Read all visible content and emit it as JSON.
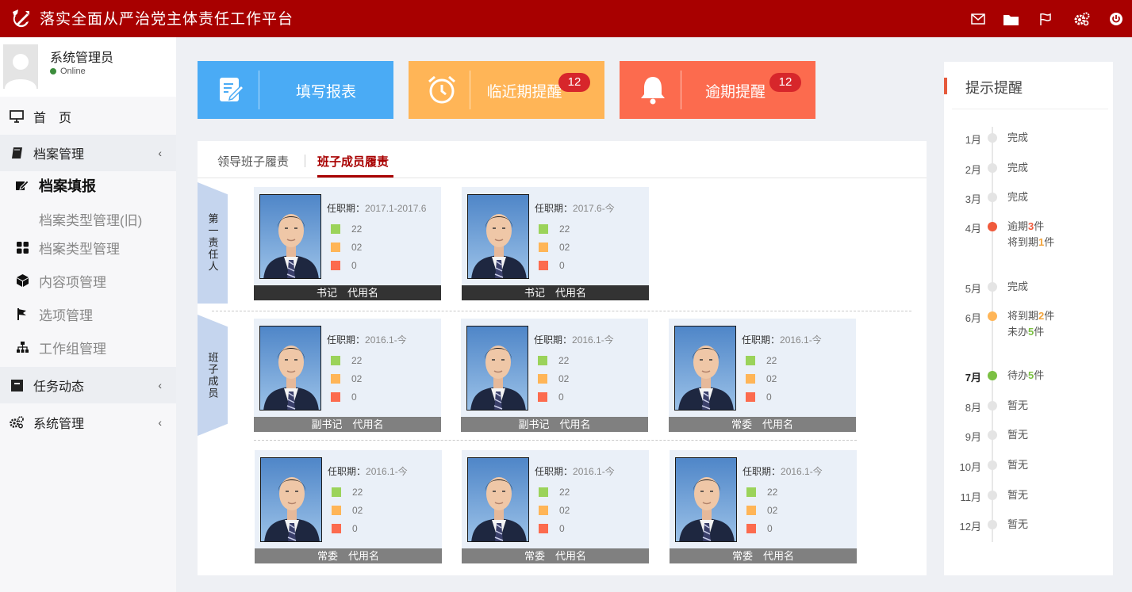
{
  "header": {
    "title": "落实全面从严治党主体责任工作平台",
    "icons": [
      "mail-icon",
      "folder-icon",
      "flag-icon",
      "settings-icon",
      "power-icon"
    ]
  },
  "user": {
    "name": "系统管理员",
    "status": "Online"
  },
  "nav": {
    "home": "首　页",
    "archive": "档案管理",
    "archive_fill": "档案填报",
    "archive_type_old": "档案类型管理(旧)",
    "archive_type": "档案类型管理",
    "content": "内容项管理",
    "options": "选项管理",
    "workgroup": "工作组管理",
    "task": "任务动态",
    "system": "系统管理"
  },
  "actions": [
    {
      "label": "填写报表",
      "color": "#4aabf5"
    },
    {
      "label": "临近期提醒",
      "badge": "12",
      "color": "#ffb557"
    },
    {
      "label": "逾期提醒",
      "badge": "12",
      "color": "#fc6b4e"
    }
  ],
  "tabs": {
    "tab1": "领导班子履责",
    "tab2": "班子成员履责"
  },
  "sections": {
    "first": "第一责任人",
    "members": "班子成员"
  },
  "term_label": "任职期：",
  "status_colors": {
    "done": "#9bd35a",
    "pending": "#ffb557",
    "overdue": "#fc6b4e"
  },
  "cards": [
    {
      "term": "2017.1-2017.6",
      "done": "22",
      "pending": "02",
      "overdue": "0",
      "footer": "书记　代用名"
    },
    {
      "term": "2017.6-今",
      "done": "22",
      "pending": "02",
      "overdue": "0",
      "footer": "书记　代用名"
    },
    {
      "term": "2016.1-今",
      "done": "22",
      "pending": "02",
      "overdue": "0",
      "footer": "副书记　代用名"
    },
    {
      "term": "2016.1-今",
      "done": "22",
      "pending": "02",
      "overdue": "0",
      "footer": "副书记　代用名"
    },
    {
      "term": "2016.1-今",
      "done": "22",
      "pending": "02",
      "overdue": "0",
      "footer": "常委　代用名"
    },
    {
      "term": "2016.1-今",
      "done": "22",
      "pending": "02",
      "overdue": "0",
      "footer": "常委　代用名"
    },
    {
      "term": "2016.1-今",
      "done": "22",
      "pending": "02",
      "overdue": "0",
      "footer": "常委　代用名"
    },
    {
      "term": "2016.1-今",
      "done": "22",
      "pending": "02",
      "overdue": "0",
      "footer": "常委　代用名"
    }
  ],
  "reminder": {
    "title": "提示提醒",
    "timeline": [
      {
        "month": "1月",
        "text": "完成"
      },
      {
        "month": "2月",
        "text": "完成"
      },
      {
        "month": "3月",
        "text": "完成"
      },
      {
        "month": "4月",
        "line1_pre": "逾期",
        "line1_num": "3",
        "line1_post": "件",
        "line2_pre": "将到期",
        "line2_num": "1",
        "line2_post": "件"
      },
      {
        "month": "5月",
        "text": "完成"
      },
      {
        "month": "6月",
        "line1_pre": "将到期",
        "line1_num": "2",
        "line1_post": "件",
        "line2_pre": "未办",
        "line2_num": "5",
        "line2_post": "件"
      },
      {
        "month": "7月",
        "line1_pre": "待办",
        "line1_num": "5",
        "line1_post": "件"
      },
      {
        "month": "8月",
        "text": "暂无"
      },
      {
        "month": "9月",
        "text": "暂无"
      },
      {
        "month": "10月",
        "text": "暂无"
      },
      {
        "month": "11月",
        "text": "暂无"
      },
      {
        "month": "12月",
        "text": "暂无"
      }
    ]
  }
}
